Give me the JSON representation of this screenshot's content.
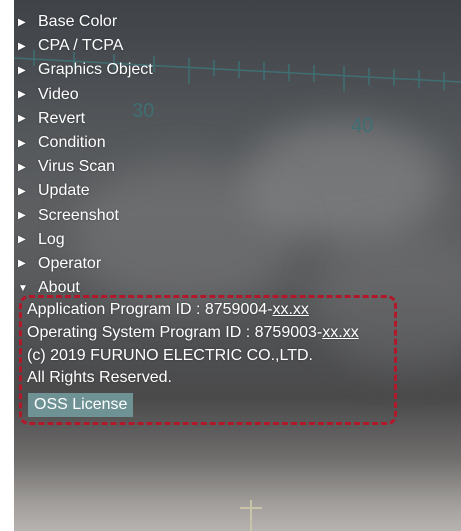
{
  "menu": {
    "items": [
      {
        "label": "Base Color",
        "arrow": "▶"
      },
      {
        "label": "CPA / TCPA",
        "arrow": "▶"
      },
      {
        "label": "Graphics Object",
        "arrow": "▶"
      },
      {
        "label": "Video",
        "arrow": "▶"
      },
      {
        "label": "Revert",
        "arrow": "▶"
      },
      {
        "label": "Condition",
        "arrow": "▶"
      },
      {
        "label": "Virus Scan",
        "arrow": "▶"
      },
      {
        "label": "Update",
        "arrow": "▶"
      },
      {
        "label": "Screenshot",
        "arrow": "▶"
      },
      {
        "label": "Log",
        "arrow": "▶"
      },
      {
        "label": "Operator",
        "arrow": "▶"
      },
      {
        "label": "About",
        "arrow": "▼"
      }
    ]
  },
  "about": {
    "app_id_prefix": "Application Program ID : 8759004-",
    "app_id_suffix": "xx.xx",
    "os_id_prefix": "Operating System Program ID : 8759003-",
    "os_id_suffix": "xx.xx",
    "copyright": "(c) 2019 FURUNO ELECTRIC CO.,LTD.",
    "rights": "All Rights Reserved.",
    "oss_button": "OSS License"
  },
  "heading_scale": {
    "label_30": "30",
    "label_40": "40"
  },
  "colors": {
    "menu_text": "#ffffff",
    "highlight_border": "#b3172a",
    "button_bg": "#6f9295",
    "scale": "#3f6f73"
  }
}
